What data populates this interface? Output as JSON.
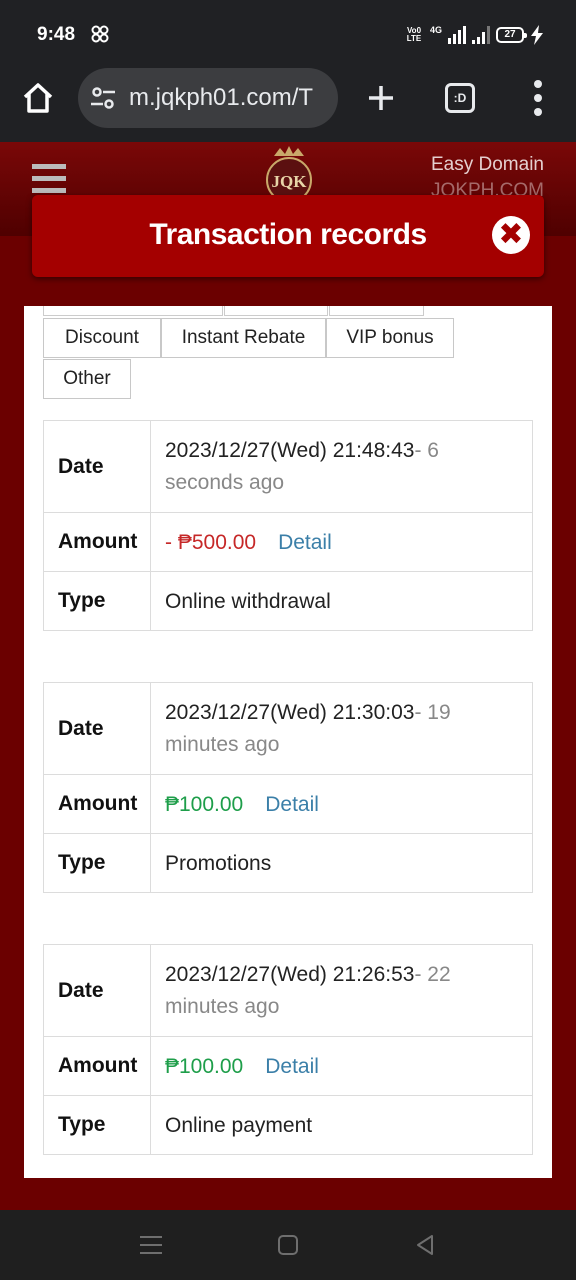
{
  "status_bar": {
    "time": "9:48",
    "volte_line1": "Vo0",
    "volte_line2": "LTE",
    "network": "4G",
    "battery": "27"
  },
  "browser": {
    "url": "m.jqkph01.com/T",
    "tabs_label": ":D"
  },
  "site_header": {
    "logo_text": "JQK",
    "domain_line1": "Easy Domain",
    "domain_line2": "JQKPH.COM"
  },
  "modal": {
    "title": "Transaction records",
    "close_glyph": "✖",
    "tabs": [
      "Discount",
      "Instant Rebate",
      "VIP bonus",
      "Other"
    ],
    "records": [
      {
        "date_label": "Date",
        "date": "2023/12/27(Wed) 21:48:43",
        "ago": "- 6 seconds ago",
        "amount_label": "Amount",
        "amount": "- ₱500.00",
        "detail": "Detail",
        "type_label": "Type",
        "type": "Online withdrawal"
      },
      {
        "date_label": "Date",
        "date": "2023/12/27(Wed) 21:30:03",
        "ago": "- 19 minutes ago",
        "amount_label": "Amount",
        "amount": "₱100.00",
        "detail": "Detail",
        "type_label": "Type",
        "type": "Promotions"
      },
      {
        "date_label": "Date",
        "date": "2023/12/27(Wed) 21:26:53",
        "ago": "- 22 minutes ago",
        "amount_label": "Amount",
        "amount": "₱100.00",
        "detail": "Detail",
        "type_label": "Type",
        "type": "Online payment"
      }
    ]
  },
  "colors": {
    "negative_amount": "#c62828",
    "positive_amount": "#1e9e4a",
    "modal_header": "#a40000",
    "detail_link": "#3b7fa8"
  },
  "icons": {
    "status": [
      "pinwheel-icon",
      "signal-icon",
      "battery-icon",
      "charging-icon"
    ],
    "browser": [
      "home-icon",
      "tune-icon",
      "plus-icon",
      "tabs-icon",
      "more-vert-icon"
    ],
    "site": [
      "hamburger-icon",
      "logo-icon",
      "close-icon"
    ],
    "nav": [
      "recents-icon",
      "home-nav-icon",
      "back-icon"
    ]
  }
}
